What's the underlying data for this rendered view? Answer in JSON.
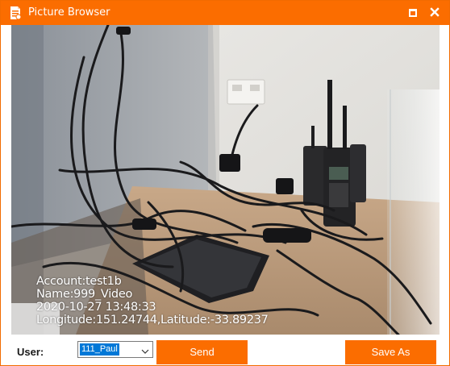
{
  "window": {
    "title": "Picture Browser",
    "accent_color": "#fb6d00",
    "icons": [
      "document-icon",
      "maximize-icon",
      "close-icon"
    ]
  },
  "photo": {
    "overlay_lines": [
      "Account:test1b",
      "Name:999_Video",
      "2020-10-27 13:48:33",
      "Longitude:151.24744,Latitude:-33.89237"
    ]
  },
  "footer": {
    "user_label": "User:",
    "user_selected": "111_Paul",
    "send_label": "Send",
    "save_as_label": "Save As"
  }
}
